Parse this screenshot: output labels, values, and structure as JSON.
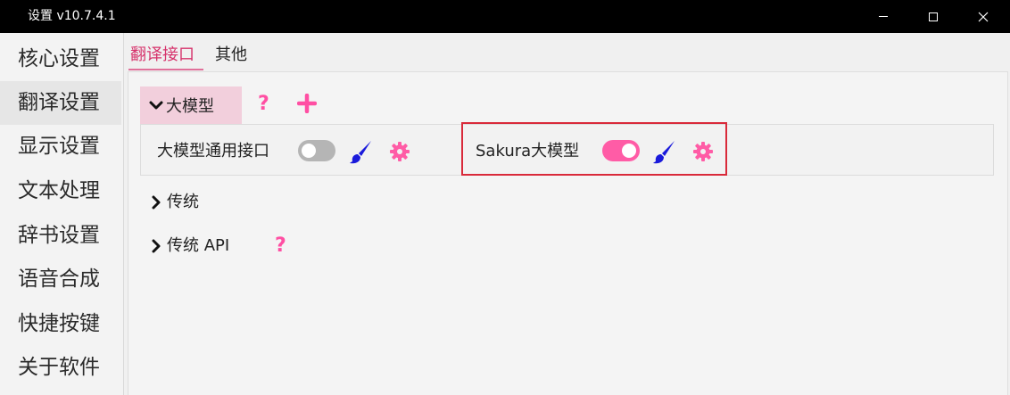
{
  "window": {
    "title": "设置 v10.7.4.1",
    "controls": {
      "minimize": "minimize-icon",
      "maximize": "maximize-icon",
      "close": "close-icon"
    }
  },
  "sidebar": {
    "items": [
      {
        "label": "核心设置",
        "active": false
      },
      {
        "label": "翻译设置",
        "active": true
      },
      {
        "label": "显示设置",
        "active": false
      },
      {
        "label": "文本处理",
        "active": false
      },
      {
        "label": "辞书设置",
        "active": false
      },
      {
        "label": "语音合成",
        "active": false
      },
      {
        "label": "快捷按键",
        "active": false
      },
      {
        "label": "关于软件",
        "active": false
      }
    ]
  },
  "tabs": [
    {
      "label": "翻译接口",
      "active": true
    },
    {
      "label": "其他",
      "active": false
    }
  ],
  "groups": {
    "llm": {
      "label": "大模型",
      "expanded": true,
      "help_icon": "question-mark-icon",
      "add_icon": "plus-icon",
      "items": [
        {
          "label": "大模型通用接口",
          "enabled": false,
          "style_icon": "brush-icon",
          "settings_icon": "gear-icon"
        },
        {
          "label": "Sakura大模型",
          "enabled": true,
          "style_icon": "brush-icon",
          "settings_icon": "gear-icon"
        }
      ]
    },
    "traditional": {
      "label": "传统",
      "expanded": false
    },
    "traditional_api": {
      "label": "传统 API",
      "expanded": false,
      "help_icon": "question-mark-icon"
    }
  },
  "colors": {
    "accent_pink": "#ff5ca6",
    "active_tab": "#d6336c",
    "group_header_bg": "#f2cfdc",
    "brush_blue": "#1a1adb",
    "highlight_red": "#d92a3a",
    "toggle_off": "#b5b5b5"
  }
}
